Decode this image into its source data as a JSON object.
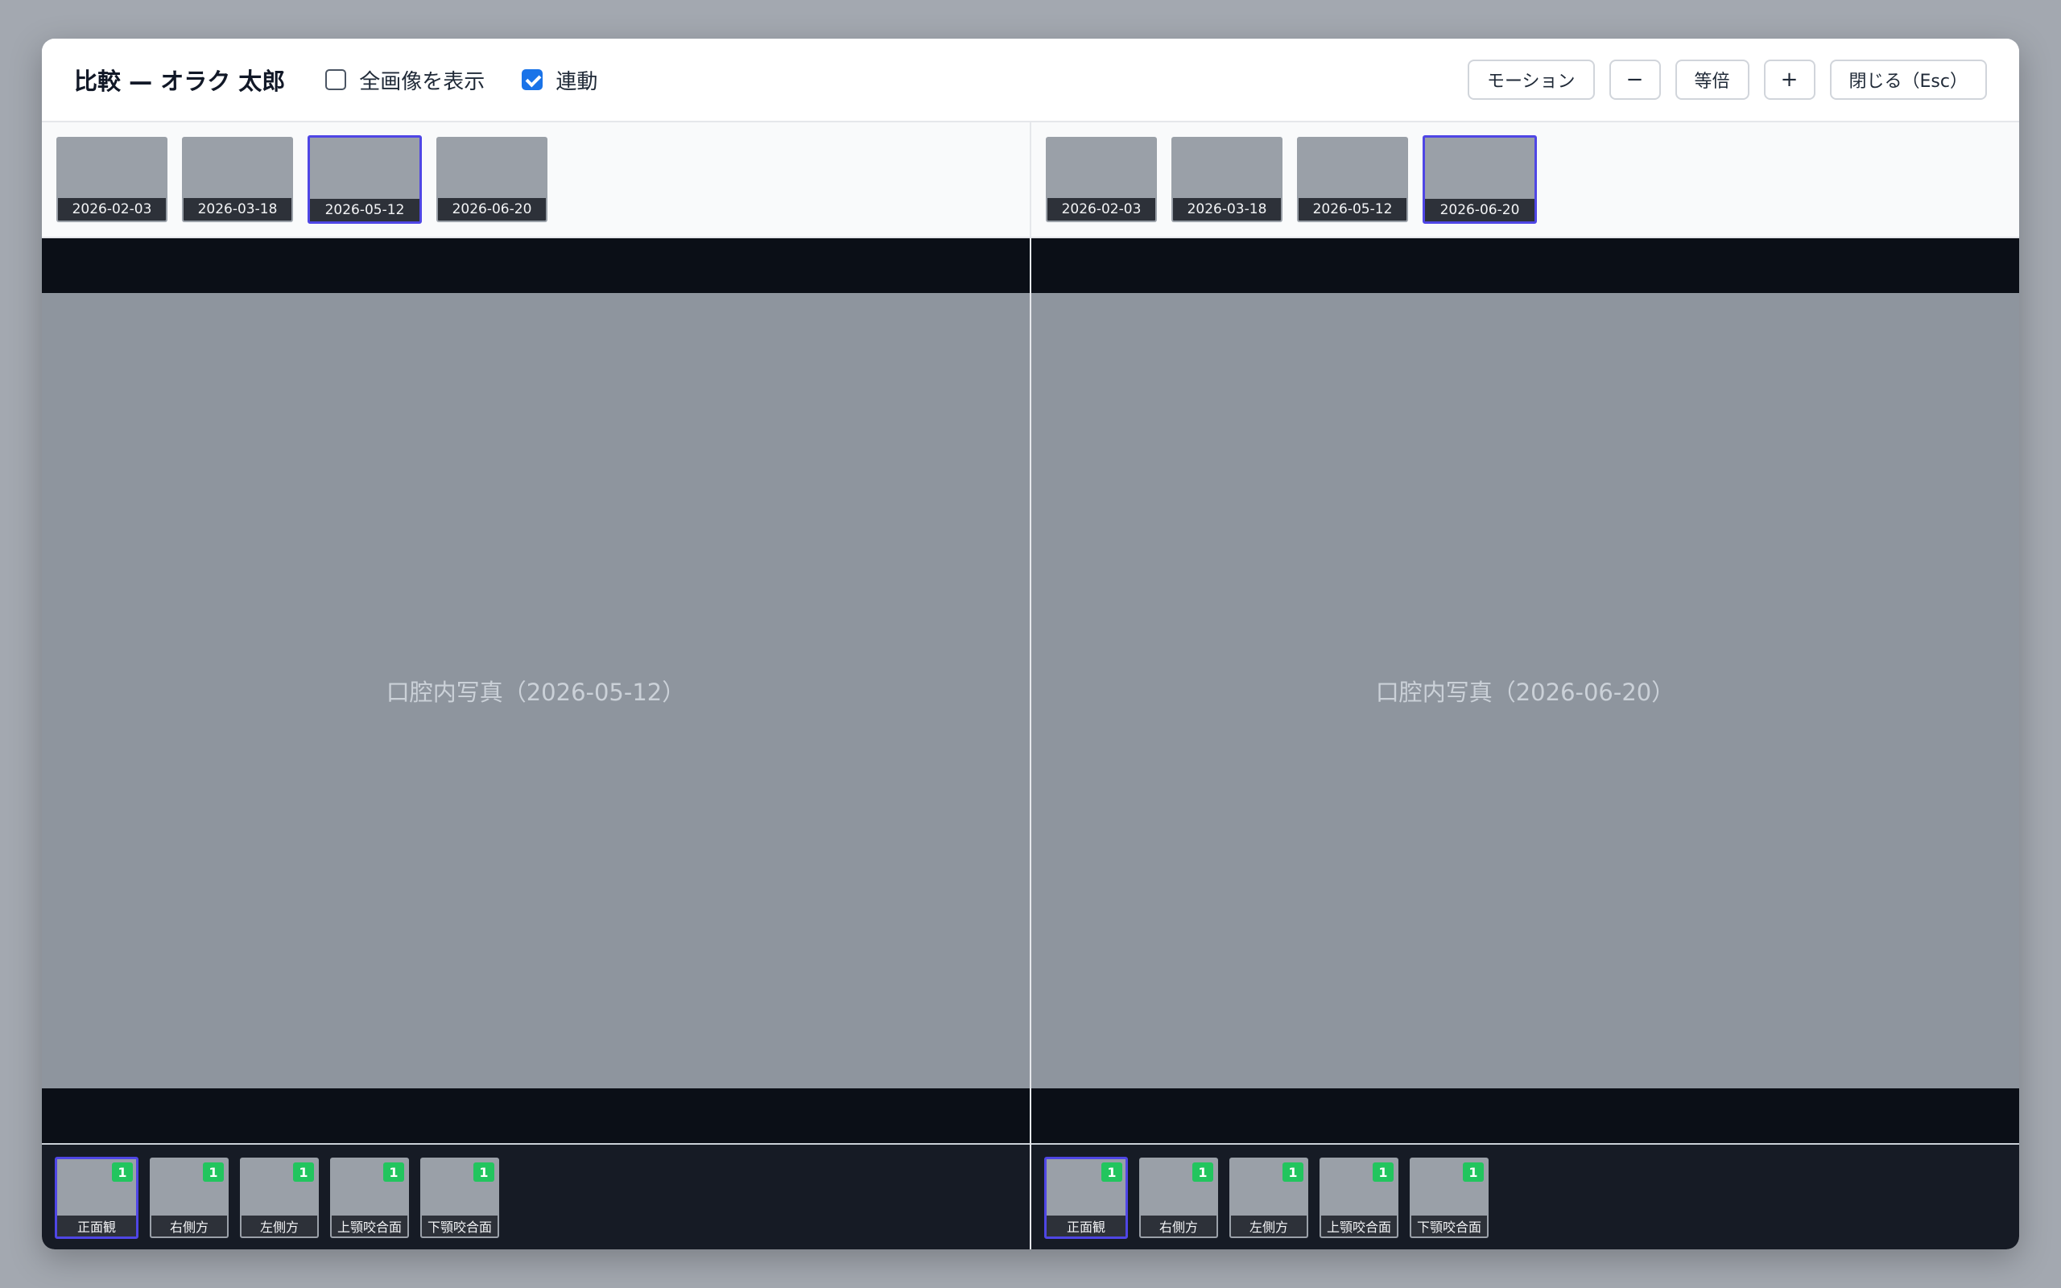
{
  "header": {
    "title": "比較 — オラク 太郎",
    "show_full_label": "全画像を表示",
    "show_full_checked": false,
    "sync_label": "連動",
    "sync_checked": true,
    "motion_label": "モーション",
    "zoom_out_label": "−",
    "actual_size_label": "等倍",
    "zoom_in_label": "+",
    "close_label": "閉じる（Esc）"
  },
  "colors": {
    "accent": "#4f46e5",
    "badge": "#22c55e",
    "checkbox": "#1a73e8"
  },
  "left": {
    "dates": [
      "2026-02-03",
      "2026-03-18",
      "2026-05-12",
      "2026-06-20"
    ],
    "selected_date": "2026-05-12",
    "photo_label": "口腔内写真（2026-05-12）",
    "views": [
      {
        "label": "正面観",
        "count": "1"
      },
      {
        "label": "右側方",
        "count": "1"
      },
      {
        "label": "左側方",
        "count": "1"
      },
      {
        "label": "上顎咬合面",
        "count": "1"
      },
      {
        "label": "下顎咬合面",
        "count": "1"
      }
    ],
    "selected_view": "正面観"
  },
  "right": {
    "dates": [
      "2026-02-03",
      "2026-03-18",
      "2026-05-12",
      "2026-06-20"
    ],
    "selected_date": "2026-06-20",
    "photo_label": "口腔内写真（2026-06-20）",
    "views": [
      {
        "label": "正面観",
        "count": "1"
      },
      {
        "label": "右側方",
        "count": "1"
      },
      {
        "label": "左側方",
        "count": "1"
      },
      {
        "label": "上顎咬合面",
        "count": "1"
      },
      {
        "label": "下顎咬合面",
        "count": "1"
      }
    ],
    "selected_view": "正面観"
  }
}
